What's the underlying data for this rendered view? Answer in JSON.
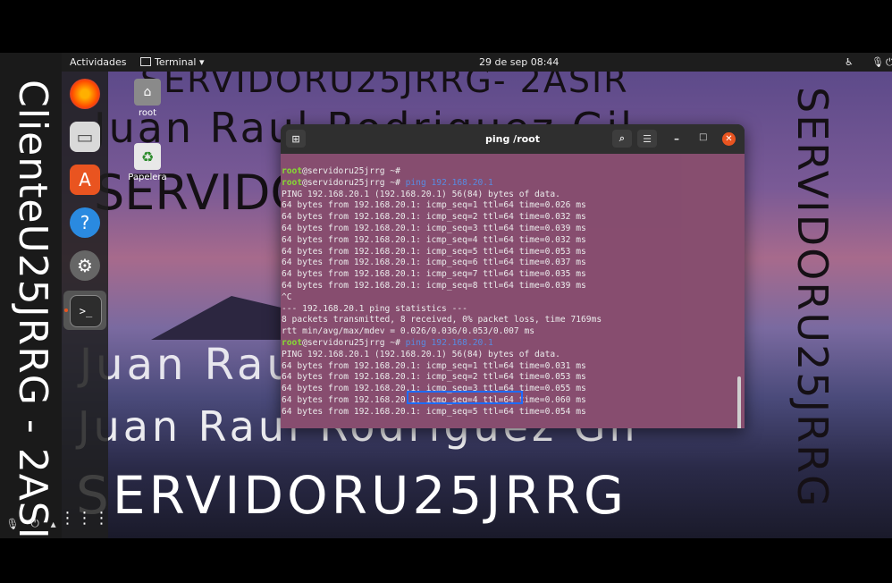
{
  "host": {
    "vertical_label": "ClienteU25JRRG - 2ASI"
  },
  "topbar": {
    "activities": "Actividades",
    "app_menu": "Terminal ▾",
    "clock": "29 de sep  08:44"
  },
  "desktop": {
    "icons": [
      {
        "label": "root",
        "icon": "home-folder-icon"
      },
      {
        "label": "Papelera",
        "icon": "trash-icon"
      }
    ],
    "watermarks": {
      "server_line_top": "SERVIDORU25JRRG- 2ASIR",
      "name_line_top": "Juan Raul Rodriguez Gil",
      "server_line_mid": "SERVIDORU25JRRG- 2ASIR",
      "name_line_mid": "Juan Raul Rodriguez Gil",
      "name_line_low": "Juan Raul Rodriguez Gil",
      "server_bottom": "SERVIDORU25JRRG",
      "vertical_right": "SERVIDORU25JRRG"
    }
  },
  "dock": {
    "apps": [
      "firefox-icon",
      "files-icon",
      "software-icon",
      "help-icon",
      "settings-icon",
      "terminal-icon",
      "app-grid-icon"
    ]
  },
  "terminal": {
    "title": "ping /root",
    "lines": [
      {
        "user": "root",
        "host": "@servidoru25jrrg ~#",
        "cmd": ""
      },
      {
        "user": "root",
        "host": "@servidoru25jrrg ~#",
        "cmd": " ping 192.168.20.1"
      },
      {
        "text": "PING 192.168.20.1 (192.168.20.1) 56(84) bytes of data."
      },
      {
        "text": "64 bytes from 192.168.20.1: icmp_seq=1 ttl=64 time=0.026 ms"
      },
      {
        "text": "64 bytes from 192.168.20.1: icmp_seq=2 ttl=64 time=0.032 ms"
      },
      {
        "text": "64 bytes from 192.168.20.1: icmp_seq=3 ttl=64 time=0.039 ms"
      },
      {
        "text": "64 bytes from 192.168.20.1: icmp_seq=4 ttl=64 time=0.032 ms"
      },
      {
        "text": "64 bytes from 192.168.20.1: icmp_seq=5 ttl=64 time=0.053 ms"
      },
      {
        "text": "64 bytes from 192.168.20.1: icmp_seq=6 ttl=64 time=0.037 ms"
      },
      {
        "text": "64 bytes from 192.168.20.1: icmp_seq=7 ttl=64 time=0.035 ms"
      },
      {
        "text": "64 bytes from 192.168.20.1: icmp_seq=8 ttl=64 time=0.039 ms"
      },
      {
        "text": "^C"
      },
      {
        "text": "--- 192.168.20.1 ping statistics ---"
      },
      {
        "text": "8 packets transmitted, 8 received, 0% packet loss, time 7169ms"
      },
      {
        "text": "rtt min/avg/max/mdev = 0.026/0.036/0.053/0.007 ms"
      },
      {
        "user": "root",
        "host": "@servidoru25jrrg ~#",
        "cmd": " ping 192.168.20.1"
      },
      {
        "text": "PING 192.168.20.1 (192.168.20.1) 56(84) bytes of data."
      },
      {
        "text": "64 bytes from 192.168.20.1: icmp_seq=1 ttl=64 time=0.031 ms"
      },
      {
        "text": "64 bytes from 192.168.20.1: icmp_seq=2 ttl=64 time=0.053 ms"
      },
      {
        "text": "64 bytes from 192.168.20.1: icmp_seq=3 ttl=64 time=0.055 ms"
      },
      {
        "text": "64 bytes from 192.168.20.1: icmp_seq=4 ttl=64 time=0.060 ms"
      },
      {
        "text": "64 bytes from 192.168.20.1: icmp_seq=5 ttl=64 time=0.054 ms"
      }
    ]
  },
  "colors": {
    "terminal_bg": "#8a4f72",
    "prompt_user": "#8ae234",
    "command": "#5a8fe8",
    "highlight_box": "#1e6bff",
    "close_button": "#e95420"
  }
}
